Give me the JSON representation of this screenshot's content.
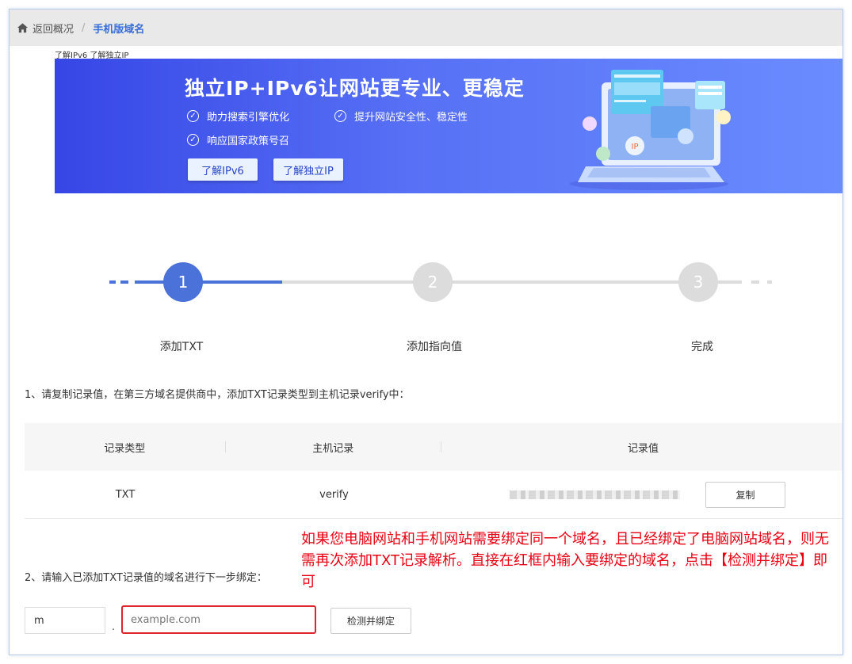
{
  "breadcrumb": {
    "back_label": "返回概况",
    "separator": "/",
    "current": "手机版域名"
  },
  "learn_links": {
    "ipv6": "了解IPv6",
    "ip": "了解独立IP"
  },
  "banner": {
    "title": "独立IP+IPv6让网站更专业、更稳定",
    "features": [
      "助力搜索引擎优化",
      "提升网站安全性、稳定性",
      "响应国家政策号召"
    ],
    "btn_ipv6": "了解IPv6",
    "btn_ip": "了解独立IP"
  },
  "steps": [
    {
      "number": "1",
      "label": "添加TXT",
      "state": "active"
    },
    {
      "number": "2",
      "label": "添加指向值",
      "state": "pending"
    },
    {
      "number": "3",
      "label": "完成",
      "state": "pending"
    }
  ],
  "instructions": {
    "step1": "1、请复制记录值，在第三方域名提供商中，添加TXT记录类型到主机记录verify中：",
    "step2": "2、请输入已添加TXT记录值的域名进行下一步绑定："
  },
  "table": {
    "headers": [
      "记录类型",
      "主机记录",
      "记录值"
    ],
    "row": {
      "type": "TXT",
      "host": "verify",
      "value_blurred": true
    },
    "copy_label": "复制"
  },
  "annotation": "如果您电脑网站和手机网站需要绑定同一个域名，且已经绑定了电脑网站域名，则无需再次添加TXT记录解析。直接在红框内输入要绑定的域名，点击【检测并绑定】即可",
  "form": {
    "subdomain_value": "m",
    "dot": ".",
    "domain_placeholder": "example.com",
    "bind_label": "检测并绑定"
  },
  "colors": {
    "accent": "#4a72d8",
    "inactive": "#dcdcdc",
    "annotation_red": "#e60012",
    "highlight_border": "#e0242e"
  }
}
